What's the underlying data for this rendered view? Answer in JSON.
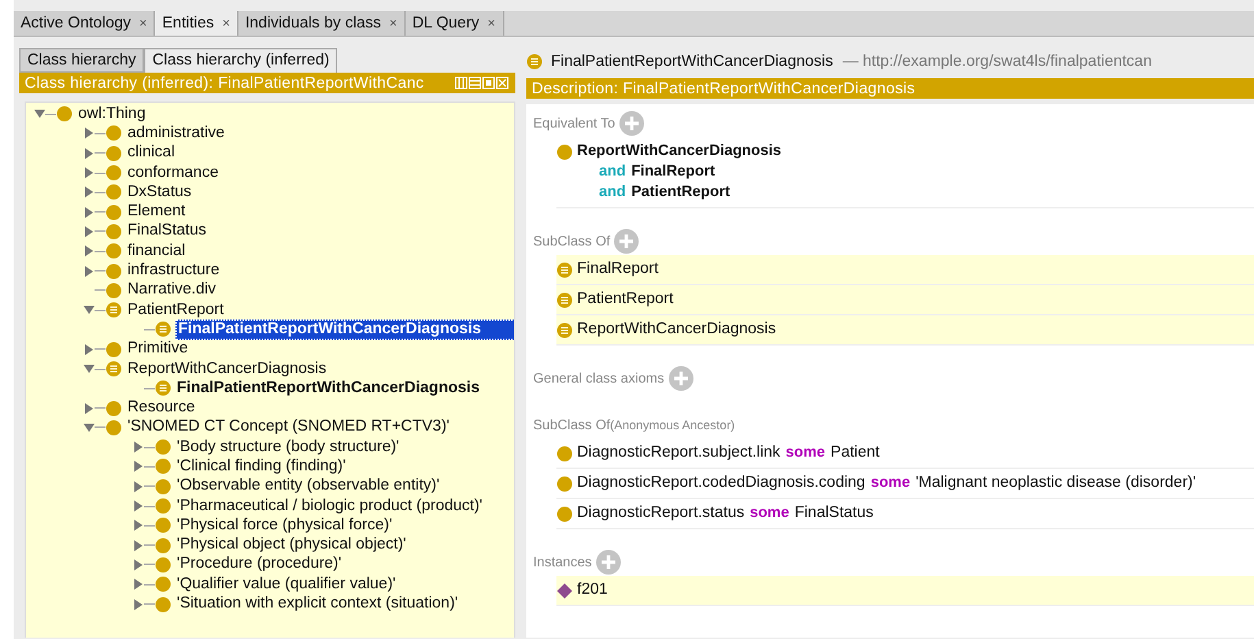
{
  "tabs": [
    {
      "label": "Active Ontology",
      "close": "×",
      "selected": false
    },
    {
      "label": "Entities",
      "close": "×",
      "selected": true
    },
    {
      "label": "Individuals by class",
      "close": "×",
      "selected": false
    },
    {
      "label": "DL Query",
      "close": "×",
      "selected": false
    }
  ],
  "left_panel": {
    "subtabs": [
      {
        "label": "Class hierarchy",
        "selected": false
      },
      {
        "label": "Class hierarchy (inferred)",
        "selected": true
      }
    ],
    "header": "Class hierarchy (inferred): FinalPatientReportWithCanc",
    "tree": [
      {
        "label": "owl:Thing",
        "kind": "class",
        "expanded": true,
        "selected": false,
        "children": [
          {
            "label": "administrative",
            "kind": "class",
            "expanded": false,
            "selected": false
          },
          {
            "label": "clinical",
            "kind": "class",
            "expanded": false,
            "selected": false
          },
          {
            "label": "conformance",
            "kind": "class",
            "expanded": false,
            "selected": false
          },
          {
            "label": "DxStatus",
            "kind": "class",
            "expanded": false,
            "selected": false
          },
          {
            "label": "Element",
            "kind": "class",
            "expanded": false,
            "selected": false
          },
          {
            "label": "FinalStatus",
            "kind": "class",
            "expanded": false,
            "selected": false
          },
          {
            "label": "financial",
            "kind": "class",
            "expanded": false,
            "selected": false
          },
          {
            "label": "infrastructure",
            "kind": "class",
            "expanded": false,
            "selected": false
          },
          {
            "label": "Narrative.div",
            "kind": "class",
            "selected": false
          },
          {
            "label": "PatientReport",
            "kind": "defined",
            "expanded": true,
            "selected": false,
            "children": [
              {
                "label": "FinalPatientReportWithCancerDiagnosis",
                "kind": "defined",
                "selected": true
              }
            ]
          },
          {
            "label": "Primitive",
            "kind": "class",
            "expanded": false,
            "selected": false
          },
          {
            "label": "ReportWithCancerDiagnosis",
            "kind": "defined",
            "expanded": true,
            "selected": false,
            "children": [
              {
                "label": "FinalPatientReportWithCancerDiagnosis",
                "kind": "defined",
                "selected": false,
                "bold": true
              }
            ]
          },
          {
            "label": "Resource",
            "kind": "class",
            "expanded": false,
            "selected": false
          },
          {
            "label": "'SNOMED CT Concept (SNOMED RT+CTV3)'",
            "kind": "class",
            "expanded": true,
            "selected": false,
            "children": [
              {
                "label": "'Body structure (body structure)'",
                "kind": "class",
                "expanded": false,
                "selected": false
              },
              {
                "label": "'Clinical finding (finding)'",
                "kind": "class",
                "expanded": false,
                "selected": false
              },
              {
                "label": "'Observable entity (observable entity)'",
                "kind": "class",
                "expanded": false,
                "selected": false
              },
              {
                "label": "'Pharmaceutical / biologic product (product)'",
                "kind": "class",
                "expanded": false,
                "selected": false
              },
              {
                "label": "'Physical force (physical force)'",
                "kind": "class",
                "expanded": false,
                "selected": false
              },
              {
                "label": "'Physical object (physical object)'",
                "kind": "class",
                "expanded": false,
                "selected": false
              },
              {
                "label": "'Procedure (procedure)'",
                "kind": "class",
                "expanded": false,
                "selected": false
              },
              {
                "label": "'Qualifier value (qualifier value)'",
                "kind": "class",
                "expanded": false,
                "selected": false
              },
              {
                "label": "'Situation with explicit context (situation)'",
                "kind": "class",
                "expanded": false,
                "selected": false
              }
            ]
          }
        ]
      }
    ]
  },
  "right_panel": {
    "entity": {
      "name": "FinalPatientReportWithCancerDiagnosis",
      "iri": "— http://example.org/swat4ls/finalpatientcan"
    },
    "header": "Description: FinalPatientReportWithCancerDiagnosis",
    "sections": [
      {
        "title": "Equivalent To",
        "addable": true,
        "kind": "expression",
        "items": [
          {
            "kind": "class",
            "lines": [
              [
                {
                  "text": "ReportWithCancerDiagnosis",
                  "kind": "name"
                }
              ],
              [
                {
                  "text": "and",
                  "kind": "connective"
                },
                {
                  "text": "FinalReport",
                  "kind": "name"
                }
              ],
              [
                {
                  "text": "and",
                  "kind": "connective"
                },
                {
                  "text": "PatientReport",
                  "kind": "name"
                }
              ]
            ]
          }
        ]
      },
      {
        "title": "SubClass Of",
        "addable": true,
        "kind": "list",
        "items": [
          {
            "kind": "defined",
            "lines": [
              [
                {
                  "text": "FinalReport",
                  "kind": "plain"
                }
              ]
            ]
          },
          {
            "kind": "defined",
            "lines": [
              [
                {
                  "text": "PatientReport",
                  "kind": "plain"
                }
              ]
            ]
          },
          {
            "kind": "defined",
            "lines": [
              [
                {
                  "text": "ReportWithCancerDiagnosis",
                  "kind": "plain"
                }
              ]
            ]
          }
        ]
      },
      {
        "title": "General class axioms",
        "addable": true,
        "kind": "list"
      },
      {
        "title": "SubClass Of",
        "subtitle": "(Anonymous Ancestor)",
        "addable": false,
        "kind": "inherited",
        "items": [
          {
            "kind": "class",
            "lines": [
              [
                {
                  "text": "DiagnosticReport.subject.link",
                  "kind": "plain"
                },
                {
                  "text": "some",
                  "kind": "restriction"
                },
                {
                  "text": "Patient",
                  "kind": "plain"
                }
              ]
            ]
          },
          {
            "kind": "class",
            "lines": [
              [
                {
                  "text": "DiagnosticReport.codedDiagnosis.coding",
                  "kind": "plain"
                },
                {
                  "text": "some",
                  "kind": "restriction"
                },
                {
                  "text": "'Malignant neoplastic disease (disorder)'",
                  "kind": "plain"
                }
              ]
            ]
          },
          {
            "kind": "class",
            "lines": [
              [
                {
                  "text": "DiagnosticReport.status",
                  "kind": "plain"
                },
                {
                  "text": "some",
                  "kind": "restriction"
                },
                {
                  "text": "FinalStatus",
                  "kind": "plain"
                }
              ]
            ]
          }
        ]
      },
      {
        "title": "Instances",
        "addable": true,
        "kind": "list",
        "items": [
          {
            "kind": "individual",
            "lines": [
              [
                {
                  "text": "f201",
                  "kind": "plain"
                }
              ]
            ]
          }
        ]
      }
    ]
  }
}
